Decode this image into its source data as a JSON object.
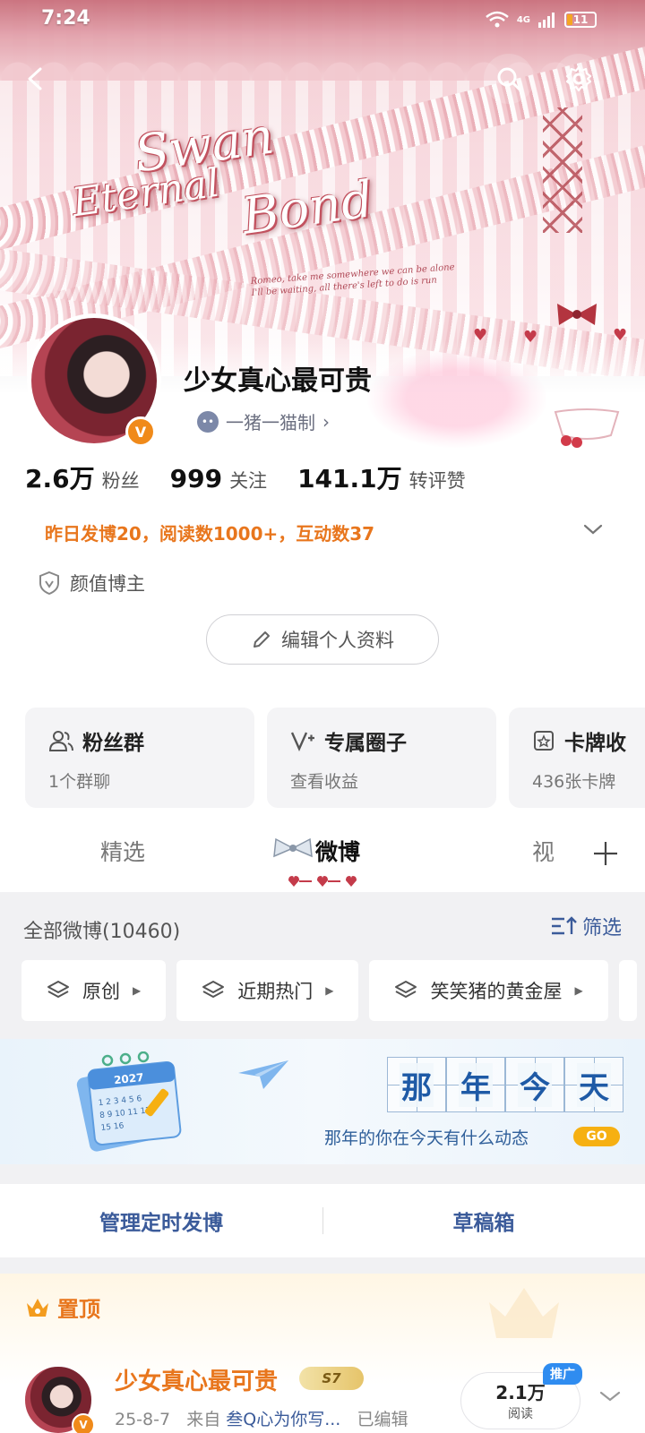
{
  "status_bar": {
    "time": "7:24",
    "network": "4G",
    "battery": "11"
  },
  "banner": {
    "script_line1": "Swan",
    "script_line2": "Eternal",
    "script_line3": "Bond",
    "caption_line1": "Romeo, take me somewhere we can be alone",
    "caption_line2": "I'll be waiting, all there's left to do is run"
  },
  "profile": {
    "username": "少女真心最可贵",
    "subname": "一猪一猫制",
    "subname_arrow": "›",
    "verified_mark": "V",
    "stats": [
      {
        "num": "2.6万",
        "label": "粉丝"
      },
      {
        "num": "999",
        "label": "关注"
      },
      {
        "num": "141.1万",
        "label": "转评赞"
      }
    ],
    "highlight": "昨日发博20，阅读数1000+，互动数37",
    "tag": "颜值博主",
    "edit_label": "编辑个人资料"
  },
  "cards": [
    {
      "title": "粉丝群",
      "sub": "1个群聊",
      "icon": "people-icon"
    },
    {
      "title": "专属圈子",
      "sub": "查看收益",
      "icon": "vplus-icon"
    },
    {
      "title": "卡牌收",
      "sub": "436张卡牌",
      "icon": "card-star-icon"
    }
  ],
  "tabs": [
    {
      "label": "精选",
      "active": false
    },
    {
      "label": "微博",
      "active": true
    },
    {
      "label": "视",
      "active": false
    }
  ],
  "feed": {
    "count_label": "全部微博(10460)",
    "filter_label": "筛选",
    "chips": [
      "原创",
      "近期热门",
      "笑笑猪的黄金屋"
    ]
  },
  "memory_banner": {
    "chars": [
      "那",
      "年",
      "今",
      "天"
    ],
    "subtitle": "那年的你在今天有什么动态",
    "go": "GO",
    "calendar_year": "2027",
    "calendar_days": "123456789101112131415"
  },
  "manage": {
    "scheduled": "管理定时发博",
    "drafts": "草稿箱"
  },
  "pinned": {
    "header": "置顶",
    "author": "少女真心最可贵",
    "level": "S7",
    "date": "25-8-7",
    "from_label": "来自",
    "source": "叁Q心为你写...",
    "edited": "已编辑",
    "reads_num": "2.1万",
    "reads_label": "阅读",
    "promo": "推广"
  },
  "colors": {
    "accent_orange": "#e8761d",
    "link_blue": "#3b5b9a",
    "banner_pink": "#efc0c6",
    "memory_blue": "#1e5aa6"
  }
}
